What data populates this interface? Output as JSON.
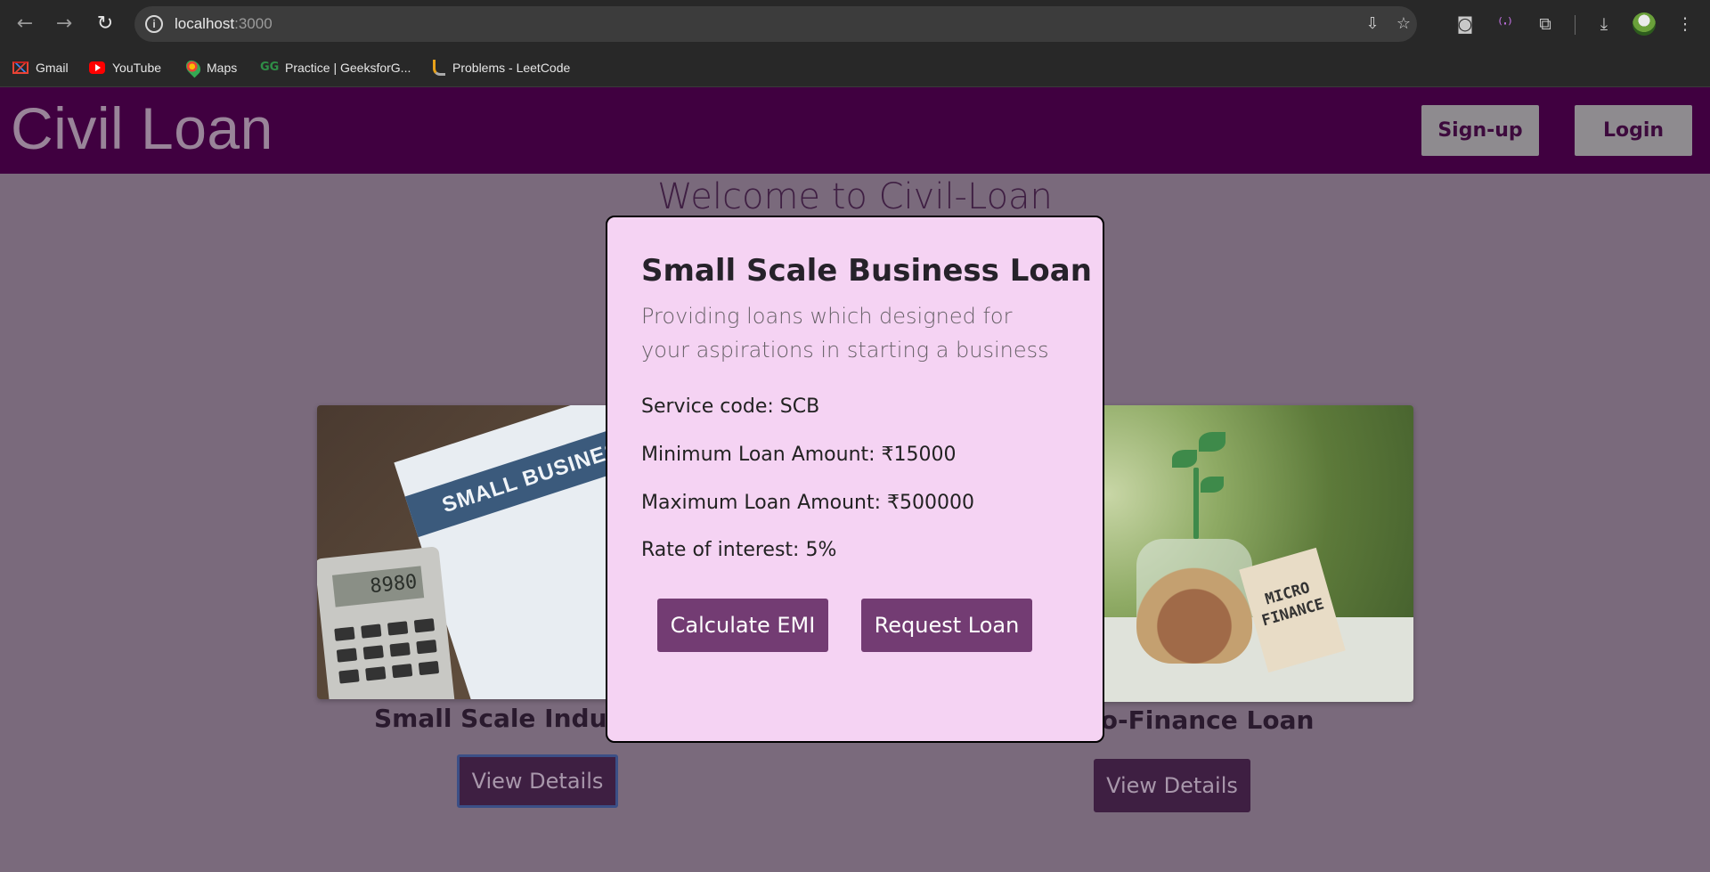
{
  "browser": {
    "url_host": "localhost",
    "url_port": ":3000",
    "bookmarks": [
      {
        "label": "Gmail",
        "icon": "gmail-icon"
      },
      {
        "label": "YouTube",
        "icon": "youtube-icon"
      },
      {
        "label": "Maps",
        "icon": "maps-icon"
      },
      {
        "label": "Practice | GeeksforG...",
        "icon": "geeksforgeeks-icon"
      },
      {
        "label": "Problems - LeetCode",
        "icon": "leetcode-icon"
      }
    ],
    "icons": {
      "back": "←",
      "forward": "→",
      "reload": "↻",
      "info": "i",
      "install": "⇩",
      "star": "☆",
      "camera": "◙",
      "extension_media": "⁽·⁾",
      "extensions": "⧉",
      "download": "⤓",
      "menu": "⋮"
    }
  },
  "header": {
    "brand": "Civil Loan",
    "signup_label": "Sign-up",
    "login_label": "Login",
    "bg_color": "#400040"
  },
  "welcome": "Welcome to Civil-Loan",
  "cards": [
    {
      "title": "Small Scale Industr",
      "button": "View Details",
      "image_text": "SMALL BUSINESS",
      "calc_display": "8980"
    },
    {
      "title": "ro-Finance Loan",
      "button": "View Details",
      "image_text_line1": "MICRO",
      "image_text_line2": "FINANCE"
    }
  ],
  "modal": {
    "title": "Small Scale Business Loan",
    "description": "Providing loans which designed for your aspirations in starting a business",
    "service_code": "Service code: SCB",
    "min_amount": "Minimum Loan Amount: ₹15000",
    "max_amount": "Maximum Loan Amount: ₹500000",
    "rate": "Rate of interest: 5%",
    "calc_button": "Calculate EMI",
    "request_button": "Request Loan",
    "bg_color": "#f5d3f3",
    "button_color": "#733c73"
  }
}
